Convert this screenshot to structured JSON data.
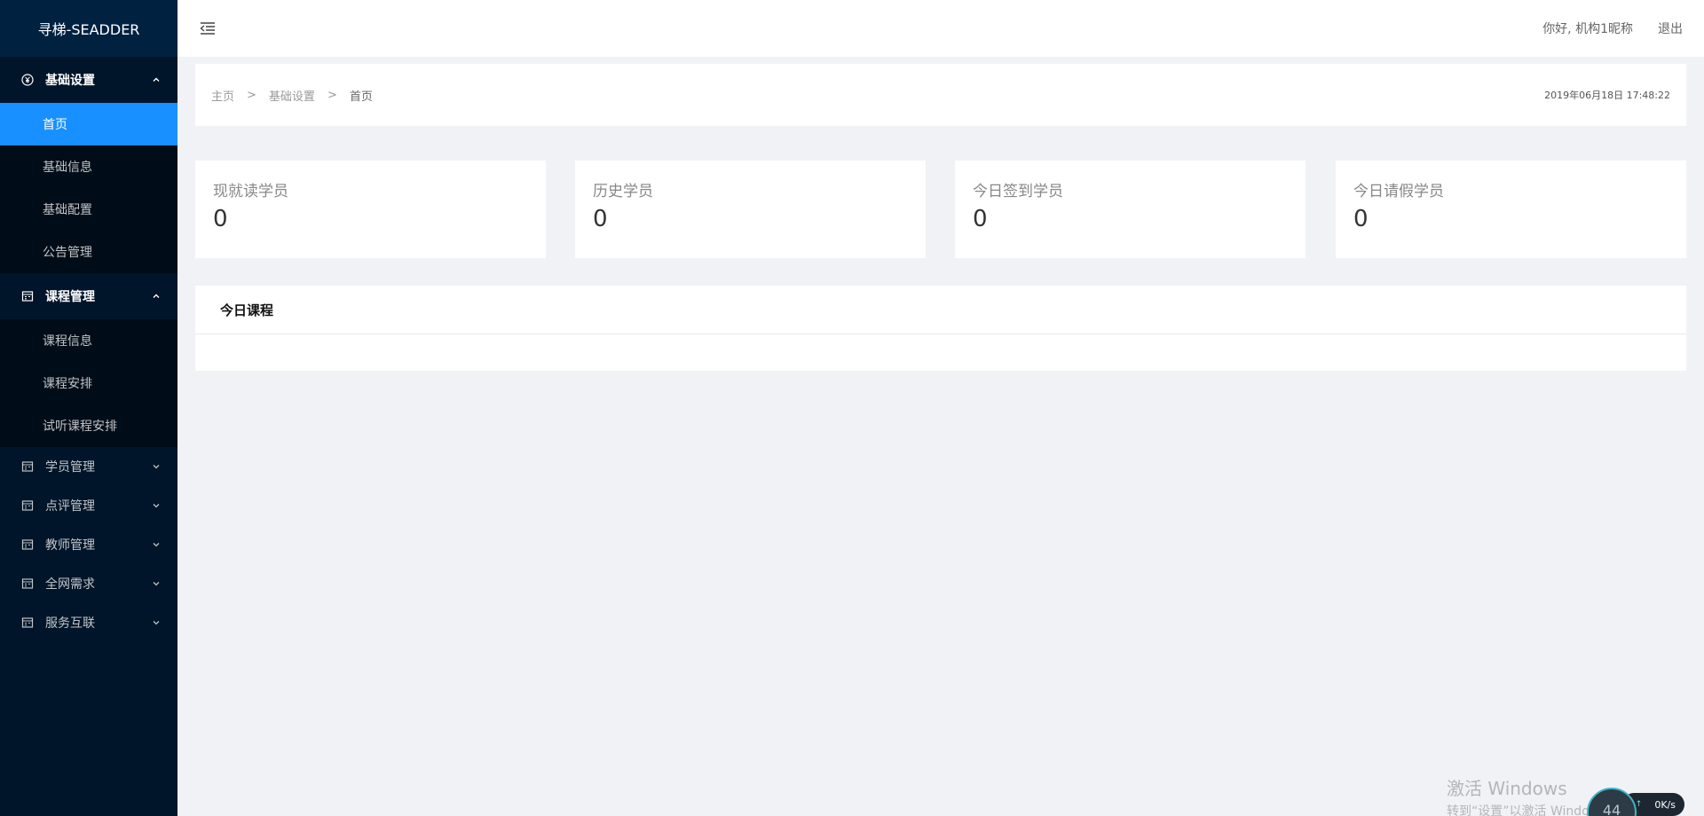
{
  "app": {
    "logo_text": "寻梯-SEADDER"
  },
  "sidebar": {
    "groups": [
      {
        "label": "基础设置",
        "icon": "yen-circle-icon",
        "expanded": true,
        "items": [
          {
            "label": "首页",
            "active": true
          },
          {
            "label": "基础信息"
          },
          {
            "label": "基础配置"
          },
          {
            "label": "公告管理"
          }
        ]
      },
      {
        "label": "课程管理",
        "icon": "calendar-icon",
        "expanded": true,
        "items": [
          {
            "label": "课程信息"
          },
          {
            "label": "课程安排"
          },
          {
            "label": "试听课程安排"
          }
        ]
      },
      {
        "label": "学员管理",
        "icon": "calendar-icon",
        "expanded": false
      },
      {
        "label": "点评管理",
        "icon": "calendar-icon",
        "expanded": false
      },
      {
        "label": "教师管理",
        "icon": "calendar-icon",
        "expanded": false
      },
      {
        "label": "全网需求",
        "icon": "calendar-icon",
        "expanded": false
      },
      {
        "label": "服务互联",
        "icon": "calendar-icon",
        "expanded": false
      }
    ]
  },
  "header": {
    "greeting": "你好, 机构1昵称",
    "logout_label": "退出"
  },
  "breadcrumb": {
    "items": [
      "主页",
      "基础设置",
      "首页"
    ],
    "separator": ">",
    "datetime": "2019年06月18日 17:48:22"
  },
  "stats": [
    {
      "label": "现就读学员",
      "value": "0"
    },
    {
      "label": "历史学员",
      "value": "0"
    },
    {
      "label": "今日签到学员",
      "value": "0"
    },
    {
      "label": "今日请假学员",
      "value": "0"
    }
  ],
  "today_course": {
    "title": "今日课程"
  },
  "watermark": {
    "line1": "激活 Windows",
    "line2": "转到“设置”以激活 Windows。"
  },
  "net_widget": {
    "percent": "44",
    "speed": "0K/s"
  },
  "colors": {
    "sidebar_bg": "#001529",
    "active_item": "#1890ff",
    "page_bg": "#f0f2f5"
  }
}
